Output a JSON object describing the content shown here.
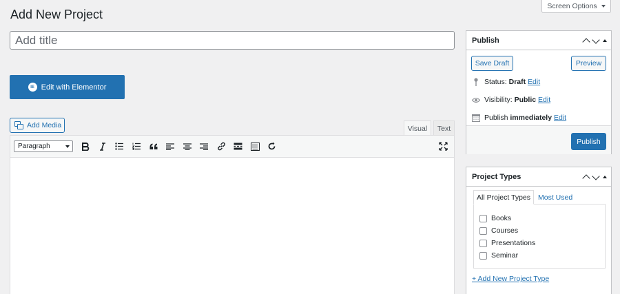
{
  "header": {
    "page_title": "Add New Project",
    "screen_options_label": "Screen Options"
  },
  "title_field": {
    "placeholder": "Add title",
    "value": ""
  },
  "elementor": {
    "button_label": "Edit with Elementor",
    "icon": "elementor-icon",
    "icon_text": "IE"
  },
  "media": {
    "add_media_label": "Add Media"
  },
  "editor": {
    "tabs": [
      {
        "label": "Visual",
        "active": true
      },
      {
        "label": "Text",
        "active": false
      }
    ],
    "format_select": "Paragraph",
    "toolbar_icons": [
      "bold-icon",
      "italic-icon",
      "bulleted-list-icon",
      "numbered-list-icon",
      "blockquote-icon",
      "align-left-icon",
      "align-center-icon",
      "align-right-icon",
      "link-icon",
      "read-more-icon",
      "toolbar-toggle-icon",
      "refresh-icon"
    ],
    "expand_icon": "fullscreen-icon",
    "content": ""
  },
  "publish_box": {
    "title": "Publish",
    "save_draft_label": "Save Draft",
    "preview_label": "Preview",
    "status": {
      "label": "Status:",
      "value": "Draft",
      "edit": "Edit"
    },
    "visibility": {
      "label": "Visibility:",
      "value": "Public",
      "edit": "Edit"
    },
    "schedule": {
      "label": "Publish",
      "value": "immediately",
      "edit": "Edit"
    },
    "publish_label": "Publish"
  },
  "project_types_box": {
    "title": "Project Types",
    "tabs": [
      "All Project Types",
      "Most Used"
    ],
    "items": [
      {
        "label": "Books",
        "checked": false
      },
      {
        "label": "Courses",
        "checked": false
      },
      {
        "label": "Presentations",
        "checked": false
      },
      {
        "label": "Seminar",
        "checked": false
      }
    ],
    "add_new_label": "+ Add New Project Type"
  },
  "colors": {
    "primary": "#2271b1",
    "background": "#f0f0f1",
    "border": "#c3c4c7"
  }
}
